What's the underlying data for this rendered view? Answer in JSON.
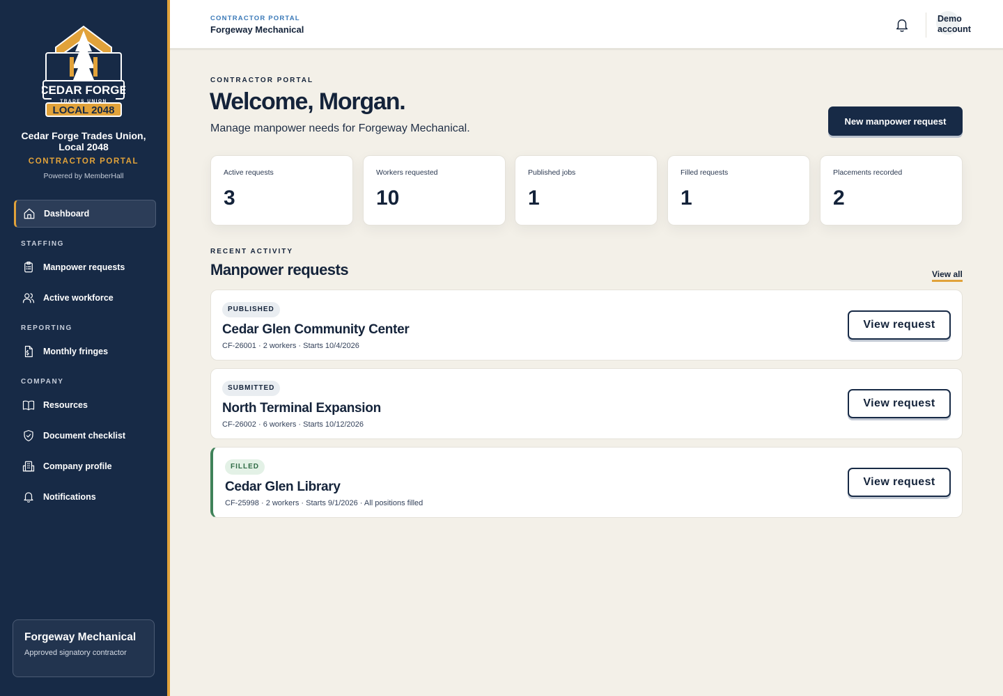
{
  "sidebar": {
    "logo": {
      "top": "CEDAR FORGE",
      "middle": "TRADES UNION",
      "bottom": "LOCAL 2048"
    },
    "org_name": "Cedar Forge Trades Union, Local 2048",
    "portal_tag": "CONTRACTOR PORTAL",
    "powered_by": "Powered by MemberHall",
    "dashboard": "Dashboard",
    "sections": {
      "staffing": "STAFFING",
      "reporting": "REPORTING",
      "company": "COMPANY"
    },
    "items": {
      "manpower_requests": "Manpower requests",
      "active_workforce": "Active workforce",
      "monthly_fringes": "Monthly fringes",
      "resources": "Resources",
      "document_checklist": "Document checklist",
      "company_profile": "Company profile",
      "notifications": "Notifications"
    },
    "company_card": {
      "name": "Forgeway Mechanical",
      "status": "Approved signatory contractor"
    }
  },
  "topbar": {
    "kicker": "CONTRACTOR PORTAL",
    "company": "Forgeway Mechanical",
    "account": "Demo account"
  },
  "main": {
    "kicker": "CONTRACTOR PORTAL",
    "welcome": "Welcome, Morgan.",
    "subtitle": "Manage manpower needs for Forgeway Mechanical.",
    "new_request_button": "New manpower request",
    "stats": [
      {
        "label": "Active requests",
        "value": "3"
      },
      {
        "label": "Workers requested",
        "value": "10"
      },
      {
        "label": "Published jobs",
        "value": "1"
      },
      {
        "label": "Filled requests",
        "value": "1"
      },
      {
        "label": "Placements recorded",
        "value": "2"
      }
    ],
    "recent_kicker": "RECENT ACTIVITY",
    "section_title": "Manpower requests",
    "view_all": "View all",
    "requests": [
      {
        "status": "PUBLISHED",
        "title": "Cedar Glen Community Center",
        "meta": "CF-26001 · 2 workers · Starts 10/4/2026",
        "button": "View request"
      },
      {
        "status": "SUBMITTED",
        "title": "North Terminal Expansion",
        "meta": "CF-26002 · 6 workers · Starts 10/12/2026",
        "button": "View request"
      },
      {
        "status": "FILLED",
        "title": "Cedar Glen Library",
        "meta": "CF-25998 · 2 workers · Starts 9/1/2026 · All positions filled",
        "button": "View request"
      }
    ]
  },
  "colors": {
    "sidebar_bg": "#172a46",
    "accent": "#e1a23a",
    "page_bg": "#f3f0e8",
    "filled_green": "#3f8259",
    "link_blue": "#3a79b8"
  }
}
